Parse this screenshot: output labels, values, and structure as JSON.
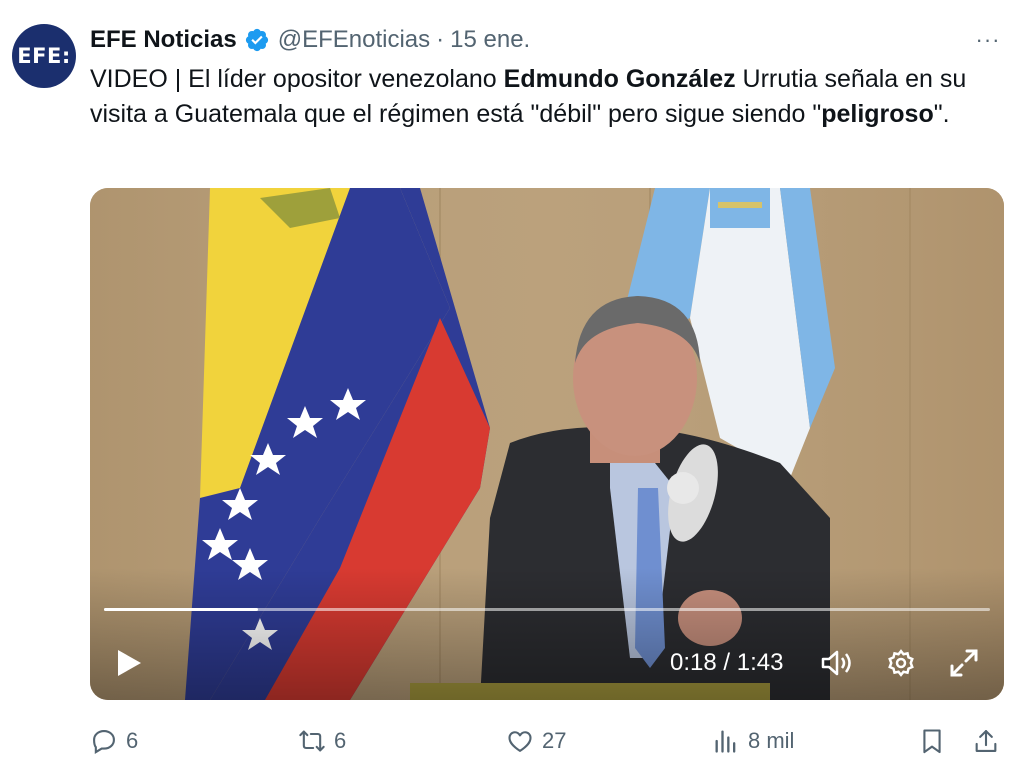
{
  "author": {
    "avatar_text": "EFE:",
    "name": "EFE Noticias",
    "handle": "@EFEnoticias",
    "separator": "·",
    "date": "15 ene.",
    "more_label": "···"
  },
  "tweet": {
    "t1": "VIDEO | El líder opositor venezolano ",
    "b1": "Edmundo González",
    "t2": " Urrutia señala en su visita a Guatemala que el régimen está \"débil\" pero sigue siendo \"",
    "b2": "peligroso",
    "t3": "\"."
  },
  "video": {
    "time_text": "0:18 / 1:43",
    "progress_fraction": 0.174
  },
  "actions": {
    "replies": "6",
    "reposts": "6",
    "likes": "27",
    "views": "8 mil"
  },
  "colors": {
    "text": "#0f1419",
    "secondary": "#536471",
    "verified": "#1d9bf0",
    "avatar_bg": "#1b2f6e"
  },
  "icons": [
    "verified-badge-icon",
    "more-icon",
    "play-icon",
    "volume-icon",
    "settings-icon",
    "fullscreen-icon",
    "reply-icon",
    "repost-icon",
    "like-icon",
    "views-icon",
    "bookmark-icon",
    "share-icon"
  ]
}
